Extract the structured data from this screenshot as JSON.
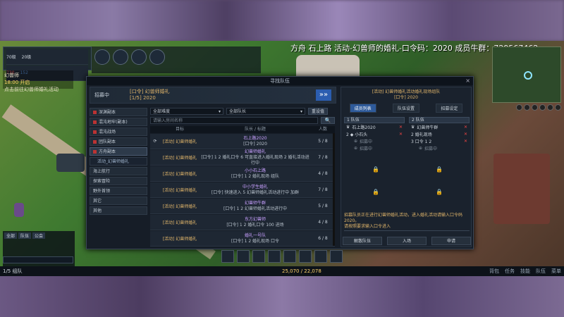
{
  "stream_title": "方舟 石上路 活动-幻兽师的婚礼-口令码：2020 成员牛群：729567462",
  "hud": {
    "level": "70级",
    "level2": "20级",
    "hp": "730",
    "mp": "152",
    "quest_title": "幻兽师",
    "quest_time": "18:00 开启",
    "quest_sub": "点击前往幻兽师婚礼活动"
  },
  "window": {
    "title": "寻找队伍",
    "close": "×",
    "banner_label": "招募中",
    "banner_info1": "[口令] 幻兽师婚礼",
    "banner_info2": "[1/5] 2020",
    "banner_arrow": "»»"
  },
  "categories": [
    {
      "label": "深渊副本",
      "red": true
    },
    {
      "label": "混沌地牢(副本)",
      "red": true
    },
    {
      "label": "混沌战场",
      "red": true
    },
    {
      "label": "团队副本",
      "red": true
    },
    {
      "label": "方舟副本",
      "red": true,
      "active": true
    },
    {
      "label": "活动_幻兽师婚礼",
      "sub": true
    },
    {
      "label": "海上航行",
      "red": false
    },
    {
      "label": "探索冒险",
      "red": false
    },
    {
      "label": "野外首领",
      "red": false
    },
    {
      "label": "其它",
      "red": false
    },
    {
      "label": "其他",
      "red": false
    }
  ],
  "filters": {
    "select1": "全部难度",
    "select2": "全部队长",
    "btn": "重设值",
    "search_placeholder": "请输入房间名称",
    "search_btn": "🔍"
  },
  "table": {
    "headers": [
      "",
      "目标",
      "队长 / 标题",
      "人数"
    ],
    "rows": [
      {
        "target": "[活动] 幻兽师婚礼",
        "t1": "石上路2020",
        "t2": "[口令] 2020",
        "count": "5 / 8"
      },
      {
        "target": "[活动] 幻兽师婚礼",
        "t1": "幻兽师婚礼",
        "t2": "[口令] 1 2 婚礼口令 6 可直接进入婚礼现场 2 婚礼活动进行中",
        "count": "7 / 8"
      },
      {
        "target": "[活动] 幻兽师婚礼",
        "t1": "小小石上路",
        "t2": "[口令] 1 2 婚礼现场 组队",
        "count": "4 / 8"
      },
      {
        "target": "[活动] 幻兽师婚礼",
        "t1": "中小学生婚礼",
        "t2": "[口令] 快速进入 5 幻兽师婚礼活动进行中 加群",
        "count": "7 / 8"
      },
      {
        "target": "[活动] 幻兽师婚礼",
        "t1": "幻兽师牛群",
        "t2": "[口令] 1 2 幻兽师婚礼活动进行中",
        "count": "5 / 8"
      },
      {
        "target": "[活动] 幻兽师婚礼",
        "t1": "东方幻兽师",
        "t2": "[口令] 1 2 婚礼口令 100 进场",
        "count": "4 / 8"
      },
      {
        "target": "[活动] 幻兽师婚礼",
        "t1": "婚礼一号队",
        "t2": "[口令] 1 2 婚礼现场 口令",
        "count": "6 / 8"
      }
    ]
  },
  "right": {
    "title1": "[活动] 幻兽师婚礼活动婚礼现场组队",
    "title2": "[口令] 2020",
    "tabs": [
      "成员列表",
      "队伍设置",
      "招募设定"
    ],
    "party1_header": "1 队伍",
    "party2_header": "2 队伍",
    "party1": [
      {
        "name": "石上路2020",
        "x": true
      },
      {
        "name": "2 ◆ 小石头",
        "x": true
      },
      {
        "name": "招募中",
        "x": false
      },
      {
        "name": "招募中",
        "x": false
      }
    ],
    "party2": [
      {
        "name": "幻兽师牛群",
        "x": true
      },
      {
        "name": "2 婚礼现场",
        "x": true
      },
      {
        "name": "3 口令 1 2",
        "x": true
      },
      {
        "name": "招募中",
        "x": false
      }
    ],
    "desc": "招募队员正在进行幻兽师婚礼活动，进入婚礼活动请输入口令码2020。",
    "desc2": "请按照要求输入口令进入",
    "buttons": [
      "解散队伍",
      "入场",
      "申请"
    ]
  },
  "bottom": {
    "money": "25,070 / 22,078",
    "left": "1/5 组队",
    "menu": [
      "背包",
      "任务",
      "技能",
      "队伍",
      "菜单"
    ]
  }
}
